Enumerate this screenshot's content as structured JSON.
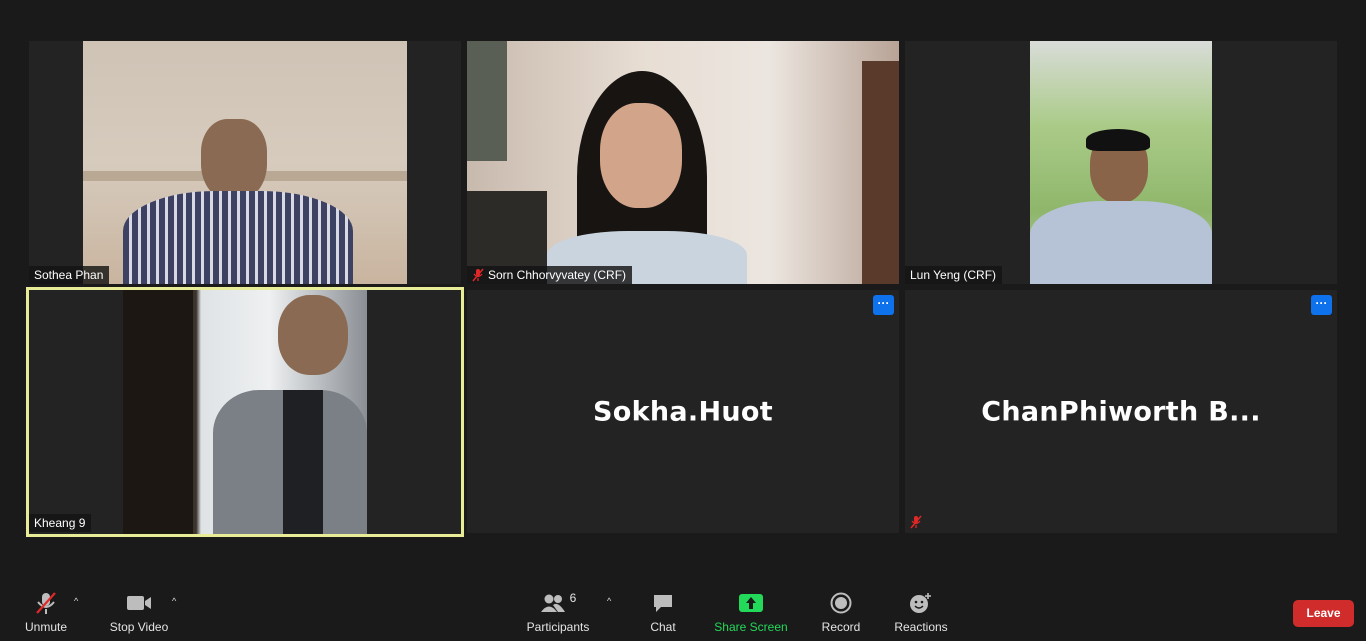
{
  "participants": {
    "sothea": {
      "name": "Sothea Phan"
    },
    "sorn": {
      "name": "Sorn Chhorvyvatey (CRF)"
    },
    "lun": {
      "name": "Lun Yeng (CRF)"
    },
    "kheang": {
      "name": "Kheang 9"
    },
    "sokha": {
      "name": "Sokha.Huot"
    },
    "chan": {
      "name": "ChanPhiworth  B..."
    }
  },
  "tile_menu_glyph": "···",
  "toolbar": {
    "unmute": "Unmute",
    "stop_video": "Stop Video",
    "participants": "Participants",
    "participants_count": "6",
    "chat": "Chat",
    "share_screen": "Share Screen",
    "record": "Record",
    "reactions": "Reactions",
    "leave": "Leave",
    "caret": "^"
  },
  "colors": {
    "background": "#1a1a1a",
    "tile": "#232323",
    "active_speaker_border": "#e9ec97",
    "share_green": "#23d959",
    "leave_red": "#d12c2c",
    "menu_blue": "#0e72ed",
    "mic_muted_red": "#e02828"
  }
}
